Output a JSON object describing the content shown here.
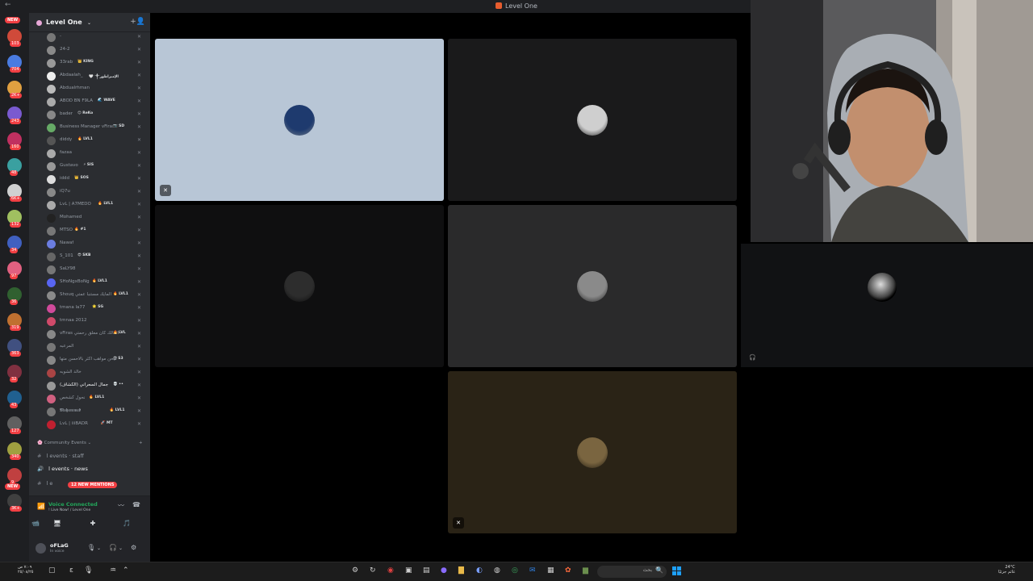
{
  "window": {
    "title": "Level One",
    "back": "←"
  },
  "rail": {
    "new_top": "NEW",
    "new_bottom": "NEW",
    "badges": [
      "103",
      "704",
      "2K+",
      "243",
      "160",
      "48",
      "6K+",
      "132",
      "34",
      "97",
      "36",
      "319",
      "363",
      "32",
      "43",
      "127",
      "340",
      "9",
      "3K+",
      "9"
    ]
  },
  "server": {
    "name": "Level One",
    "add_icon": "+👤"
  },
  "members": [
    {
      "name": "-",
      "tag": ""
    },
    {
      "name": "24-2",
      "tag": ""
    },
    {
      "name": "33rab",
      "tag": "👑 KING"
    },
    {
      "name": "Abdaalah_",
      "tag": "🤍 ༒الإمبراطور"
    },
    {
      "name": "Abdualrhman",
      "tag": ""
    },
    {
      "name": "ABOD BN F9LA",
      "tag": "🌊 WAVE"
    },
    {
      "name": "bader",
      "tag": "😊 ReKo"
    },
    {
      "name": "Business Manager vFiras",
      "tag": "📷 SD"
    },
    {
      "name": "diddy",
      "tag": "🔥 LVL1"
    },
    {
      "name": "fazaa",
      "tag": ""
    },
    {
      "name": "Gustavo",
      "tag": "⚡ SIS"
    },
    {
      "name": "iddd",
      "tag": "👑 SOS"
    },
    {
      "name": "iQ7u",
      "tag": ""
    },
    {
      "name": "LvL | A7MEDO",
      "tag": "🔥 LVL1"
    },
    {
      "name": "Mohamed",
      "tag": ""
    },
    {
      "name": "MTSO",
      "tag": "🔥 #1"
    },
    {
      "name": "Nawaf",
      "tag": ""
    },
    {
      "name": "S_101",
      "tag": "😎 SKB"
    },
    {
      "name": "SaLY98",
      "tag": ""
    },
    {
      "name": "SHoNgxBoNg",
      "tag": "🔥 LVL1"
    },
    {
      "name": "Shouq المايك مستنبا عمتي",
      "tag": "🔥 LVL1"
    },
    {
      "name": "tmana la77",
      "tag": "⭐ SG"
    },
    {
      "name": "tmnaa 2012",
      "tag": ""
    },
    {
      "name": "vFiras المالك كان معلق رحمتي",
      "tag": "🔥 LVL"
    },
    {
      "name": "المرعبه",
      "tag": ""
    },
    {
      "name": "كيحن مواهب اكثر بالاحسن متها",
      "tag": "😎 S3"
    },
    {
      "name": "خالد الشوبه",
      "tag": ""
    },
    {
      "name": "(ألكشاف) جمال السعراني",
      "tag": "💀 ••"
    },
    {
      "name": "نحول كشخص",
      "tag": "🔥 LVL1"
    },
    {
      "name": "𝕸𝖔𝖍𝖆𝖒𝖒𝖊𝖉",
      "tag": "🔥 LVL1"
    },
    {
      "name": "LvL | iiiBADR",
      "tag": "🚀 MT"
    }
  ],
  "channels": {
    "category": "Community Events ⌄",
    "category_icon": "🌸",
    "add": "+",
    "items": [
      {
        "prefix": "#",
        "label": "l events · staff",
        "unread": false
      },
      {
        "prefix": "🔊",
        "label": "l events · news",
        "unread": true
      },
      {
        "prefix": "#",
        "label": "l e",
        "unread": false
      }
    ],
    "mentions": "12 NEW MENTIONS"
  },
  "voice": {
    "status": "Voice Connected",
    "sub": "! Live Now! / Level One",
    "signal_icon": "📶",
    "noise_icon": "〰",
    "disconnect_icon": "☎",
    "buttons": [
      "📹",
      "🖥",
      "✚",
      "🎵"
    ]
  },
  "user": {
    "name": "oFLaG",
    "status": "In voice",
    "mic_icon": "🎙",
    "headset_icon": "🎧",
    "settings_icon": "⚙",
    "caret": "⌄"
  },
  "tiles": [
    {
      "id": "tile-1",
      "bg": "#b8c6d6",
      "avatar": "#1e3a6e",
      "muted": true
    },
    {
      "id": "tile-2",
      "bg": "#1a1a1b",
      "avatar": "#cfcfcf",
      "muted": false
    },
    {
      "id": "tile-3",
      "bg": "#0f0f10",
      "avatar": "#2d2d2d",
      "muted": false
    },
    {
      "id": "tile-4",
      "bg": "#2a2a2b",
      "avatar": "#8a8a8a",
      "muted": false
    },
    {
      "id": "tile-5",
      "bg": "#2a2316",
      "avatar": "#7a6540",
      "muted": true
    }
  ],
  "mute_glyph": "🎙̸",
  "right_tile_icon": "🎧",
  "taskbar": {
    "search_placeholder": "بحث",
    "search_icon": "🔍",
    "weather_temp": "24°C",
    "weather_desc": "غائم جزئيًا",
    "time": "٧:٠٩ ص",
    "date": "٢٥/٠٨/٢٥"
  }
}
